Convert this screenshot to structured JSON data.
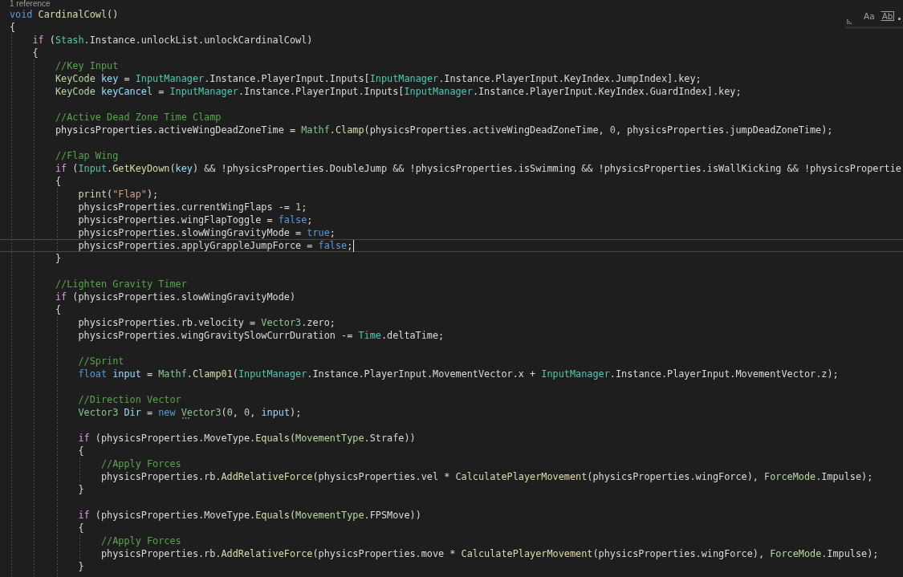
{
  "editor": {
    "codelens": "1 reference",
    "lines": [
      {
        "tokens": [
          {
            "kind": "keyword",
            "text": "void "
          },
          {
            "kind": "method",
            "text": "CardinalCowl"
          },
          {
            "kind": "plain",
            "text": "()"
          }
        ],
        "current": false
      },
      {
        "tokens": [
          {
            "kind": "plain",
            "text": "{"
          }
        ],
        "current": false,
        "children": [
          {
            "tokens": [
              {
                "kind": "control",
                "text": "if"
              },
              {
                "kind": "plain",
                "text": " ("
              },
              {
                "kind": "class",
                "text": "Stash"
              },
              {
                "kind": "plain",
                "text": ".Instance.unlockList.unlockCardinalCowl)"
              }
            ],
            "current": false
          },
          {
            "tokens": [
              {
                "kind": "plain",
                "text": "{"
              }
            ],
            "current": false,
            "children": [
              {
                "tokens": [
                  {
                    "kind": "comment",
                    "text": "//Key Input"
                  }
                ],
                "current": false
              },
              {
                "tokens": [
                  {
                    "kind": "enum",
                    "text": "KeyCode "
                  },
                  {
                    "kind": "local",
                    "text": "key"
                  },
                  {
                    "kind": "plain",
                    "text": " = "
                  },
                  {
                    "kind": "class",
                    "text": "InputManager"
                  },
                  {
                    "kind": "plain",
                    "text": ".Instance.PlayerInput.Inputs["
                  },
                  {
                    "kind": "class",
                    "text": "InputManager"
                  },
                  {
                    "kind": "plain",
                    "text": ".Instance.PlayerInput.KeyIndex.JumpIndex].key;"
                  }
                ],
                "current": false
              },
              {
                "tokens": [
                  {
                    "kind": "enum",
                    "text": "KeyCode "
                  },
                  {
                    "kind": "local",
                    "text": "keyCancel"
                  },
                  {
                    "kind": "plain",
                    "text": " = "
                  },
                  {
                    "kind": "class",
                    "text": "InputManager"
                  },
                  {
                    "kind": "plain",
                    "text": ".Instance.PlayerInput.Inputs["
                  },
                  {
                    "kind": "class",
                    "text": "InputManager"
                  },
                  {
                    "kind": "plain",
                    "text": ".Instance.PlayerInput.KeyIndex.GuardIndex].key;"
                  }
                ],
                "current": false
              },
              {
                "current": false
              },
              {
                "tokens": [
                  {
                    "kind": "comment",
                    "text": "//Active Dead Zone Time Clamp"
                  }
                ],
                "current": false
              },
              {
                "tokens": [
                  {
                    "kind": "plain",
                    "text": "physicsProperties.activeWingDeadZoneTime = "
                  },
                  {
                    "kind": "struct",
                    "text": "Mathf"
                  },
                  {
                    "kind": "plain",
                    "text": "."
                  },
                  {
                    "kind": "method",
                    "text": "Clamp"
                  },
                  {
                    "kind": "plain",
                    "text": "(physicsProperties.activeWingDeadZoneTime, "
                  },
                  {
                    "kind": "number",
                    "text": "0"
                  },
                  {
                    "kind": "plain",
                    "text": ", physicsProperties.jumpDeadZoneTime);"
                  }
                ],
                "current": false
              },
              {
                "current": false
              },
              {
                "tokens": [
                  {
                    "kind": "comment",
                    "text": "//Flap Wing"
                  }
                ],
                "current": false
              },
              {
                "tokens": [
                  {
                    "kind": "control",
                    "text": "if"
                  },
                  {
                    "kind": "plain",
                    "text": " ("
                  },
                  {
                    "kind": "class",
                    "text": "Input"
                  },
                  {
                    "kind": "plain",
                    "text": "."
                  },
                  {
                    "kind": "method",
                    "text": "GetKeyDown"
                  },
                  {
                    "kind": "plain",
                    "text": "("
                  },
                  {
                    "kind": "local",
                    "text": "key"
                  },
                  {
                    "kind": "plain",
                    "text": ") && !physicsProperties.DoubleJump && !physicsProperties.isSwimming && !physicsProperties.isWallKicking && !physicsPropertie"
                  }
                ],
                "current": false
              },
              {
                "tokens": [
                  {
                    "kind": "plain",
                    "text": "{"
                  }
                ],
                "current": false,
                "children": [
                  {
                    "tokens": [
                      {
                        "kind": "method",
                        "text": "print"
                      },
                      {
                        "kind": "plain",
                        "text": "("
                      },
                      {
                        "kind": "string",
                        "text": "\"Flap\""
                      },
                      {
                        "kind": "plain",
                        "text": ");"
                      }
                    ],
                    "current": false
                  },
                  {
                    "tokens": [
                      {
                        "kind": "plain",
                        "text": "physicsProperties.currentWingFlaps -= "
                      },
                      {
                        "kind": "number",
                        "text": "1"
                      },
                      {
                        "kind": "plain",
                        "text": ";"
                      }
                    ],
                    "current": false
                  },
                  {
                    "tokens": [
                      {
                        "kind": "plain",
                        "text": "physicsProperties.wingFlapToggle = "
                      },
                      {
                        "kind": "keyword",
                        "text": "false"
                      },
                      {
                        "kind": "plain",
                        "text": ";"
                      }
                    ],
                    "current": false
                  },
                  {
                    "tokens": [
                      {
                        "kind": "plain",
                        "text": "physicsProperties.slowWingGravityMode = "
                      },
                      {
                        "kind": "keyword",
                        "text": "true"
                      },
                      {
                        "kind": "plain",
                        "text": ";"
                      }
                    ],
                    "current": false
                  },
                  {
                    "tokens": [
                      {
                        "kind": "plain",
                        "text": "physicsProperties.applyGrappleJumpForce = "
                      },
                      {
                        "kind": "keyword",
                        "text": "false"
                      },
                      {
                        "kind": "plain",
                        "text": ";"
                      }
                    ],
                    "current": true
                  }
                ]
              },
              {
                "tokens": [
                  {
                    "kind": "plain",
                    "text": "}"
                  }
                ],
                "current": false
              },
              {
                "current": false
              },
              {
                "tokens": [
                  {
                    "kind": "comment",
                    "text": "//Lighten Gravity Timer"
                  }
                ],
                "current": false
              },
              {
                "tokens": [
                  {
                    "kind": "control",
                    "text": "if"
                  },
                  {
                    "kind": "plain",
                    "text": " (physicsProperties.slowWingGravityMode)"
                  }
                ],
                "current": false
              },
              {
                "tokens": [
                  {
                    "kind": "plain",
                    "text": "{"
                  }
                ],
                "current": false,
                "children": [
                  {
                    "tokens": [
                      {
                        "kind": "plain",
                        "text": "physicsProperties.rb.velocity = "
                      },
                      {
                        "kind": "struct",
                        "text": "Vector3"
                      },
                      {
                        "kind": "plain",
                        "text": ".zero;"
                      }
                    ],
                    "current": false
                  },
                  {
                    "tokens": [
                      {
                        "kind": "plain",
                        "text": "physicsProperties.wingGravitySlowCurrDuration -= "
                      },
                      {
                        "kind": "class",
                        "text": "Time"
                      },
                      {
                        "kind": "plain",
                        "text": ".deltaTime;"
                      }
                    ],
                    "current": false
                  },
                  {
                    "current": false
                  },
                  {
                    "tokens": [
                      {
                        "kind": "comment",
                        "text": "//Sprint"
                      }
                    ],
                    "current": false
                  },
                  {
                    "tokens": [
                      {
                        "kind": "keyword",
                        "text": "float "
                      },
                      {
                        "kind": "local",
                        "text": "input"
                      },
                      {
                        "kind": "plain",
                        "text": " = "
                      },
                      {
                        "kind": "struct",
                        "text": "Mathf"
                      },
                      {
                        "kind": "plain",
                        "text": "."
                      },
                      {
                        "kind": "method",
                        "text": "Clamp01"
                      },
                      {
                        "kind": "plain",
                        "text": "("
                      },
                      {
                        "kind": "class",
                        "text": "InputManager"
                      },
                      {
                        "kind": "plain",
                        "text": ".Instance.PlayerInput.MovementVector.x + "
                      },
                      {
                        "kind": "class",
                        "text": "InputManager"
                      },
                      {
                        "kind": "plain",
                        "text": ".Instance.PlayerInput.MovementVector.z);"
                      }
                    ],
                    "current": false
                  },
                  {
                    "current": false
                  },
                  {
                    "tokens": [
                      {
                        "kind": "comment",
                        "text": "//Direction Vector"
                      }
                    ],
                    "current": false
                  },
                  {
                    "tokens": [
                      {
                        "kind": "struct",
                        "text": "Vector3 "
                      },
                      {
                        "kind": "local",
                        "text": "Dir"
                      },
                      {
                        "kind": "plain",
                        "text": " = "
                      },
                      {
                        "kind": "keyword",
                        "text": "new "
                      },
                      {
                        "kind": "hinted",
                        "text": "Vector3"
                      },
                      {
                        "kind": "plain",
                        "text": "("
                      },
                      {
                        "kind": "number",
                        "text": "0"
                      },
                      {
                        "kind": "plain",
                        "text": ", "
                      },
                      {
                        "kind": "number",
                        "text": "0"
                      },
                      {
                        "kind": "plain",
                        "text": ", "
                      },
                      {
                        "kind": "local",
                        "text": "input"
                      },
                      {
                        "kind": "plain",
                        "text": ");"
                      }
                    ],
                    "current": false
                  },
                  {
                    "current": false
                  },
                  {
                    "tokens": [
                      {
                        "kind": "control",
                        "text": "if"
                      },
                      {
                        "kind": "plain",
                        "text": " (physicsProperties.MoveType."
                      },
                      {
                        "kind": "method",
                        "text": "Equals"
                      },
                      {
                        "kind": "plain",
                        "text": "("
                      },
                      {
                        "kind": "enum",
                        "text": "MovementType"
                      },
                      {
                        "kind": "plain",
                        "text": ".Strafe))"
                      }
                    ],
                    "current": false
                  },
                  {
                    "tokens": [
                      {
                        "kind": "plain",
                        "text": "{"
                      }
                    ],
                    "current": false,
                    "children": [
                      {
                        "tokens": [
                          {
                            "kind": "comment",
                            "text": "//Apply Forces"
                          }
                        ],
                        "current": false
                      },
                      {
                        "tokens": [
                          {
                            "kind": "plain",
                            "text": "physicsProperties.rb."
                          },
                          {
                            "kind": "method",
                            "text": "AddRelativeForce"
                          },
                          {
                            "kind": "plain",
                            "text": "(physicsProperties.vel * "
                          },
                          {
                            "kind": "method",
                            "text": "CalculatePlayerMovement"
                          },
                          {
                            "kind": "plain",
                            "text": "(physicsProperties.wingForce), "
                          },
                          {
                            "kind": "enum",
                            "text": "ForceMode"
                          },
                          {
                            "kind": "plain",
                            "text": ".Impulse);"
                          }
                        ],
                        "current": false
                      }
                    ]
                  },
                  {
                    "tokens": [
                      {
                        "kind": "plain",
                        "text": "}"
                      }
                    ],
                    "current": false
                  },
                  {
                    "current": false
                  },
                  {
                    "tokens": [
                      {
                        "kind": "control",
                        "text": "if"
                      },
                      {
                        "kind": "plain",
                        "text": " (physicsProperties.MoveType."
                      },
                      {
                        "kind": "method",
                        "text": "Equals"
                      },
                      {
                        "kind": "plain",
                        "text": "("
                      },
                      {
                        "kind": "enum",
                        "text": "MovementType"
                      },
                      {
                        "kind": "plain",
                        "text": ".FPSMove))"
                      }
                    ],
                    "current": false
                  },
                  {
                    "tokens": [
                      {
                        "kind": "plain",
                        "text": "{"
                      }
                    ],
                    "current": false,
                    "children": [
                      {
                        "tokens": [
                          {
                            "kind": "comment",
                            "text": "//Apply Forces"
                          }
                        ],
                        "current": false
                      },
                      {
                        "tokens": [
                          {
                            "kind": "plain",
                            "text": "physicsProperties.rb."
                          },
                          {
                            "kind": "method",
                            "text": "AddRelativeForce"
                          },
                          {
                            "kind": "plain",
                            "text": "(physicsProperties.move * "
                          },
                          {
                            "kind": "method",
                            "text": "CalculatePlayerMovement"
                          },
                          {
                            "kind": "plain",
                            "text": "(physicsProperties.wingForce), "
                          },
                          {
                            "kind": "enum",
                            "text": "ForceMode"
                          },
                          {
                            "kind": "plain",
                            "text": ".Impulse);"
                          }
                        ],
                        "current": false
                      }
                    ]
                  },
                  {
                    "tokens": [
                      {
                        "kind": "plain",
                        "text": "}"
                      }
                    ],
                    "current": false
                  },
                  {
                    "current": false
                  }
                ]
              }
            ]
          }
        ]
      }
    ]
  },
  "find_widget": {
    "toggles": [
      {
        "kind": "case",
        "label": "Aa",
        "selected": false
      },
      {
        "kind": "word",
        "label": "Ab",
        "selected": false
      }
    ]
  }
}
